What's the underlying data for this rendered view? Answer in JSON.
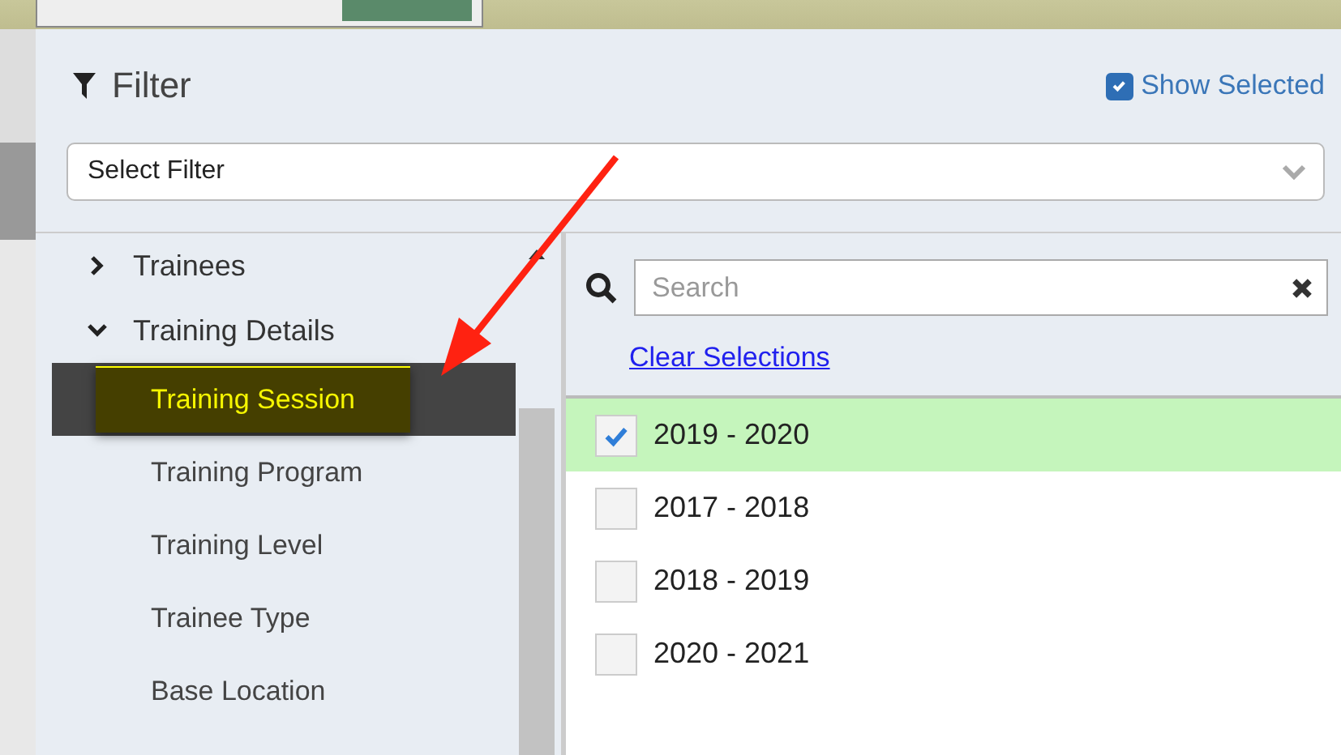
{
  "filter": {
    "title": "Filter",
    "show_selected": {
      "label": "Show Selected",
      "checked": true
    },
    "select": {
      "value": "Select Filter"
    }
  },
  "tree": [
    {
      "label": "Trainees",
      "expanded": false
    },
    {
      "label": "Training Details",
      "expanded": true,
      "children": [
        {
          "label": "Training Session",
          "selected": true
        },
        {
          "label": "Training Program",
          "selected": false
        },
        {
          "label": "Training Level",
          "selected": false
        },
        {
          "label": "Trainee Type",
          "selected": false
        },
        {
          "label": "Base Location",
          "selected": false
        }
      ]
    }
  ],
  "search": {
    "placeholder": "Search"
  },
  "clear_link": "Clear Selections",
  "options": [
    {
      "label": "2019 - 2020",
      "checked": true
    },
    {
      "label": "2017 - 2018",
      "checked": false
    },
    {
      "label": "2018 - 2019",
      "checked": false
    },
    {
      "label": "2020 - 2021",
      "checked": false
    }
  ]
}
